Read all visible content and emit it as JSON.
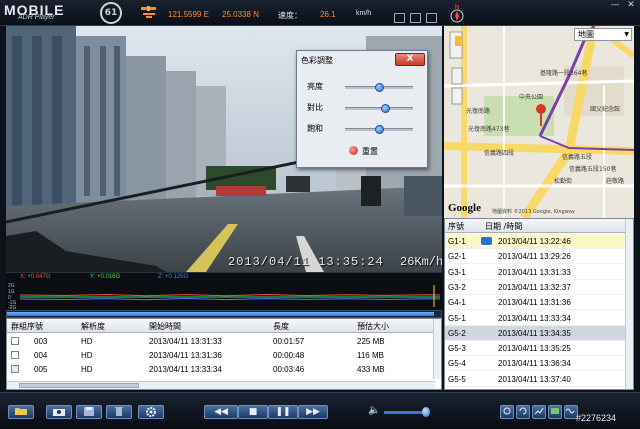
{
  "header": {
    "logo": "MOBILE",
    "logo_sub": "ADR Player",
    "longitude": "121.5599 E",
    "latitude": "25.0338 N",
    "speed_label": "速度：",
    "speed_value": "26.1",
    "speed_unit": "km/h",
    "compass": "N",
    "minimize": "—",
    "close": "✕"
  },
  "video": {
    "timestamp": "2013/04/11 13:35:24",
    "speed_overlay": "26Km/h"
  },
  "color_dialog": {
    "title": "色彩調整",
    "close": "X",
    "sliders": [
      {
        "label": "亮度",
        "value": 0.5
      },
      {
        "label": "對比",
        "value": 0.6
      },
      {
        "label": "飽和",
        "value": 0.5
      }
    ],
    "reset": "重置"
  },
  "gsensor": {
    "x": "X: +0.047G",
    "y": "Y: +0.016G",
    "z": "Z: +0.125G",
    "x_color": "#ff4a3a",
    "y_color": "#3adf55",
    "z_color": "#4a7bff",
    "ticks": [
      "2G",
      "1G",
      "0",
      "-1G",
      "-2G"
    ]
  },
  "progress": {
    "value": 0.985
  },
  "file_table": {
    "headers": [
      "群組序號",
      "解析度",
      "開始時間",
      "長度",
      "預估大小"
    ],
    "rows": [
      {
        "id": "003",
        "res": "HD",
        "start": "2013/04/11 13:31:33",
        "length": "00:01:57",
        "size": "225 MB"
      },
      {
        "id": "004",
        "res": "HD",
        "start": "2013/04/11 13:31:36",
        "length": "00:00:48",
        "size": "116 MB"
      },
      {
        "id": "005",
        "res": "HD",
        "start": "2013/04/11 13:33:34",
        "length": "00:03:46",
        "size": "433 MB"
      }
    ]
  },
  "map": {
    "select": "地圖",
    "labels": [
      "中央公園",
      "光復南路",
      "信義路四段",
      "信義路五段",
      "松勤街",
      "光復南路473巷",
      "國父紀念館",
      "信義路五段150巷",
      "莊敬路",
      "基隆路一段364巷"
    ],
    "copyright": "地圖資料 ©2013 Google, Kingway",
    "google": "Google"
  },
  "track_list": {
    "headers": [
      "序號",
      "日期 /時間"
    ],
    "rows": [
      {
        "id": "G1-1",
        "time": "2013/04/11 13:22:46"
      },
      {
        "id": "G2-1",
        "time": "2013/04/11 13:29:26"
      },
      {
        "id": "G3-1",
        "time": "2013/04/11 13:31:33"
      },
      {
        "id": "G3-2",
        "time": "2013/04/11 13:32:37"
      },
      {
        "id": "G4-1",
        "time": "2013/04/11 13:31:36"
      },
      {
        "id": "G5-1",
        "time": "2013/04/11 13:33:34"
      },
      {
        "id": "G5-2",
        "time": "2013/04/11 13:34:35"
      },
      {
        "id": "G5-3",
        "time": "2013/04/11 13:35:25"
      },
      {
        "id": "G5-4",
        "time": "2013/04/11 13:36:34"
      },
      {
        "id": "G5-5",
        "time": "2013/04/11 13:37:40"
      }
    ]
  },
  "toolbar": {
    "rewind": "◀◀",
    "stop": "■",
    "pause": "❚❚",
    "forward": "▶▶",
    "volume_icon": "🔈",
    "volume": 0.8
  },
  "watermark": "#2276234"
}
